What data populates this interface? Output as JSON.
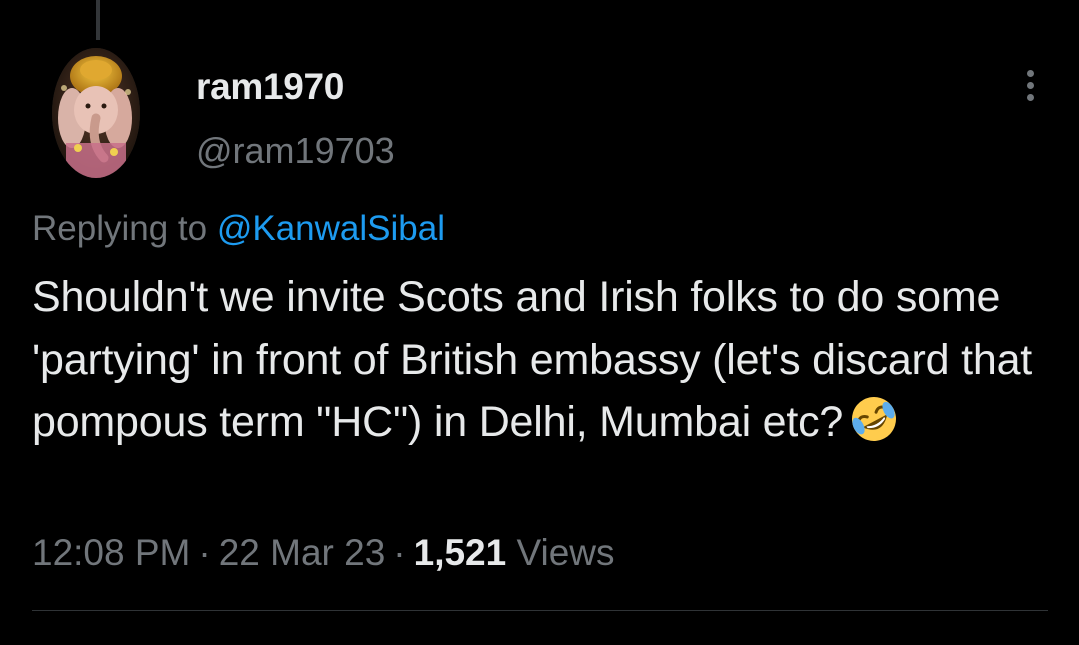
{
  "tweet": {
    "display_name": "ram1970",
    "handle": "@ram19703",
    "replying_prefix": "Replying to",
    "replying_to": "@KanwalSibal",
    "text": "Shouldn't we invite Scots and Irish folks to do some 'partying' in front of British embassy (let's discard that pompous term \"HC\") in Delhi, Mumbai etc?",
    "emoji": "rolling-on-floor-laughing",
    "time": "12:08 PM",
    "separator": "·",
    "date": "22 Mar 23",
    "views_count": "1,521",
    "views_label": "Views"
  },
  "colors": {
    "background": "#000000",
    "primary_text": "#e7e9ea",
    "secondary_text": "#71767b",
    "link": "#1d9bf0",
    "divider": "#2f3336"
  },
  "icons": {
    "more": "more-vertical-icon",
    "avatar": "user-avatar-ganesha-image"
  }
}
